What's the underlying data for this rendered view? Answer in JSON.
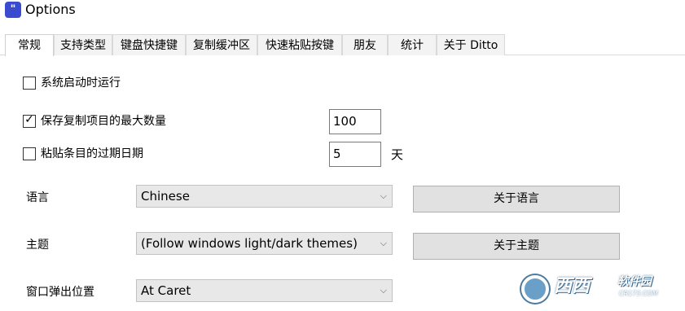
{
  "window": {
    "title": "Options",
    "icon": "ditto-app-icon"
  },
  "tabs": [
    {
      "label": "常规",
      "active": true
    },
    {
      "label": "支持类型"
    },
    {
      "label": "键盘快捷键"
    },
    {
      "label": "复制缓冲区"
    },
    {
      "label": "快速粘贴按键"
    },
    {
      "label": "朋友"
    },
    {
      "label": "统计"
    },
    {
      "label": "关于 Ditto"
    }
  ],
  "general": {
    "run_on_startup": {
      "label": "系统启动时运行",
      "checked": false
    },
    "max_copies": {
      "label": "保存复制项目的最大数量",
      "checked": true,
      "value": "100"
    },
    "expire": {
      "label": "粘贴条目的过期日期",
      "checked": false,
      "value": "5",
      "unit": "天"
    },
    "language": {
      "label": "语言",
      "value": "Chinese",
      "button": "关于语言"
    },
    "theme": {
      "label": "主题",
      "value": "(Follow windows light/dark themes)",
      "button": "关于主题"
    },
    "popup_position": {
      "label": "窗口弹出位置",
      "value": "At Caret"
    }
  },
  "watermark": {
    "text": "西西",
    "sub": "软件园",
    "url": "CR173.COM"
  }
}
